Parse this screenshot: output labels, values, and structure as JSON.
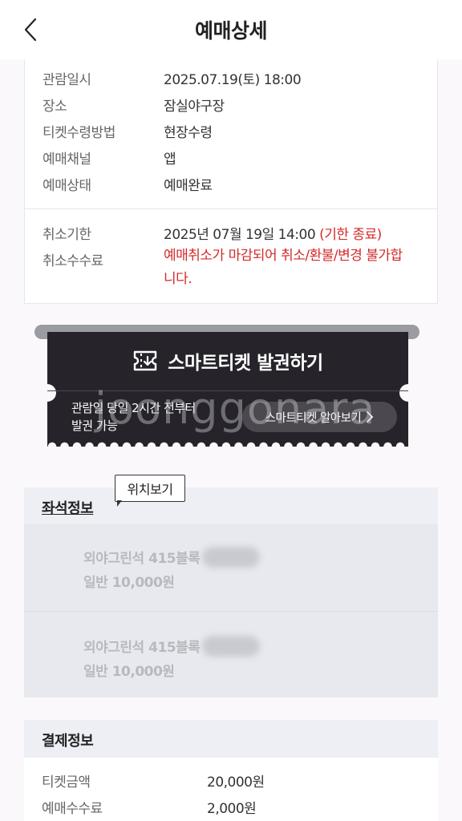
{
  "header": {
    "title": "예매상세",
    "back_icon": "chevron-left-icon"
  },
  "info": {
    "rows": [
      {
        "label": "관람일시",
        "value": "2025.07.19(토) 18:00"
      },
      {
        "label": "장소",
        "value": "잠실야구장"
      },
      {
        "label": "티켓수령방법",
        "value": "현장수령"
      },
      {
        "label": "예매채널",
        "value": "앱"
      },
      {
        "label": "예매상태",
        "value": "예매완료"
      }
    ],
    "cancel_deadline_label": "취소기한",
    "cancel_deadline_value": "2025년 07월 19일 14:00",
    "cancel_deadline_note": "(기한 종료)",
    "cancel_fee_label": "취소수수료",
    "cancel_fee_line1": "예매취소가 마감되어 취소/환불/변경 불가합",
    "cancel_fee_line2": "니다.",
    "warning_color": "#d42a2a"
  },
  "smart_ticket": {
    "title": "스마트티켓 발권하기",
    "sub_line1": "관람일 당일 2시간 전부터",
    "sub_line2": "발권 가능",
    "guide_label": "스마트티켓 알아보기",
    "watermark": "joonggonara"
  },
  "tooltip": {
    "label": "위치보기"
  },
  "seat": {
    "title": "좌석정보",
    "items": [
      {
        "line1": "외야그린석 415블록",
        "line2": "일반 10,000원"
      },
      {
        "line1": "외야그린석 415블록",
        "line2": "일반 10,000원"
      }
    ]
  },
  "payment": {
    "title": "결제정보",
    "rows": [
      {
        "label": "티켓금액",
        "value": "20,000원"
      },
      {
        "label": "예매수수료",
        "value": "2,000원"
      }
    ]
  }
}
